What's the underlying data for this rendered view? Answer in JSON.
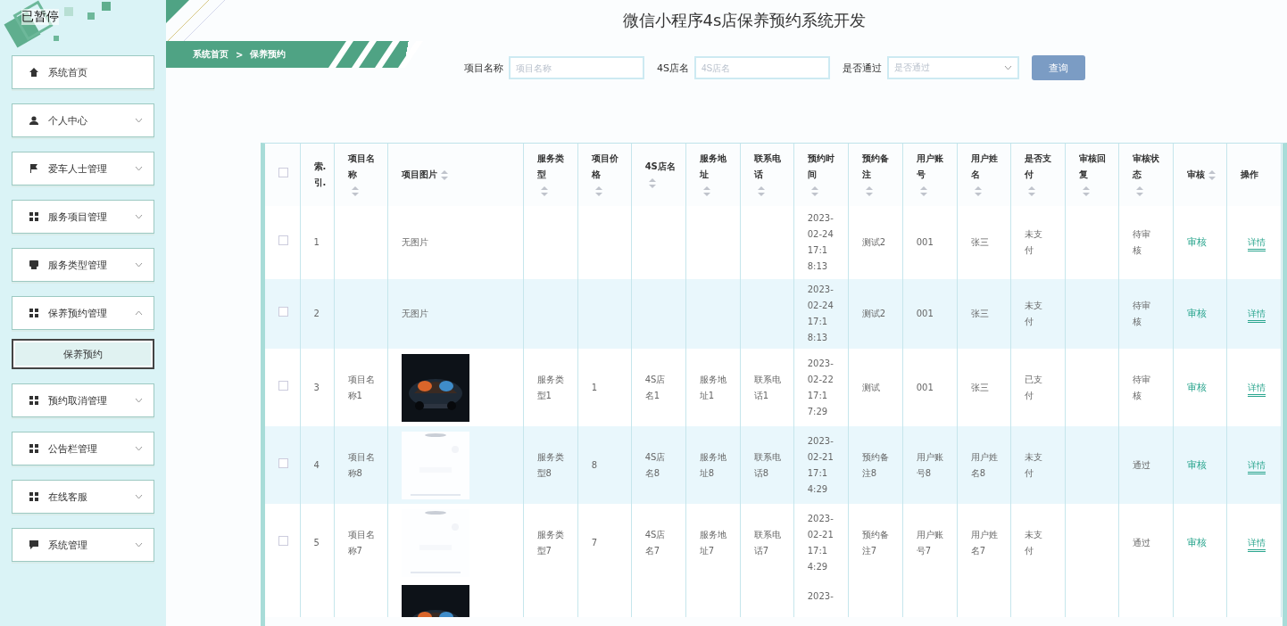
{
  "overlay_text": "已暂停",
  "sidebar": {
    "items": [
      {
        "label": "系统首页",
        "has_children": false
      },
      {
        "label": "个人中心",
        "has_children": true,
        "expanded": false
      },
      {
        "label": "爱车人士管理",
        "has_children": true,
        "expanded": false
      },
      {
        "label": "服务项目管理",
        "has_children": true,
        "expanded": false
      },
      {
        "label": "服务类型管理",
        "has_children": true,
        "expanded": false
      },
      {
        "label": "保养预约管理",
        "has_children": true,
        "expanded": true,
        "children": [
          {
            "label": "保养预约",
            "selected": true
          }
        ]
      },
      {
        "label": "预约取消管理",
        "has_children": true,
        "expanded": false
      },
      {
        "label": "公告栏管理",
        "has_children": true,
        "expanded": false
      },
      {
        "label": "在线客服",
        "has_children": true,
        "expanded": false
      },
      {
        "label": "系统管理",
        "has_children": true,
        "expanded": false
      }
    ]
  },
  "title": "微信小程序4s店保养预约系统开发",
  "breadcrumb": [
    "系统首页",
    ">",
    "保养预约"
  ],
  "filters": [
    {
      "kind": "text",
      "label": "项目名称",
      "placeholder": "项目名称"
    },
    {
      "kind": "text",
      "label": "4S店名",
      "placeholder": "4S店名"
    },
    {
      "kind": "select",
      "label": "是否通过",
      "placeholder": "是否通过"
    }
  ],
  "search_button": "查询",
  "table": {
    "header_checked": false,
    "columns": [
      {
        "label": "索.引.",
        "sortable": false
      },
      {
        "label": "项目名称",
        "sortable": true
      },
      {
        "label": "项目图片",
        "sortable": true
      },
      {
        "label": "服务类型",
        "sortable": true
      },
      {
        "label": "项目价格",
        "sortable": true
      },
      {
        "label": "4S店名",
        "sortable": true
      },
      {
        "label": "服务地址",
        "sortable": true
      },
      {
        "label": "联系电话",
        "sortable": true
      },
      {
        "label": "预约时间",
        "sortable": true
      },
      {
        "label": "预约备注",
        "sortable": true
      },
      {
        "label": "用户账号",
        "sortable": true
      },
      {
        "label": "用户姓名",
        "sortable": true
      },
      {
        "label": "是否支付",
        "sortable": true
      },
      {
        "label": "审核回复",
        "sortable": true
      },
      {
        "label": "审核状态",
        "sortable": true
      },
      {
        "label": "审核",
        "sortable": true
      },
      {
        "label": "操作",
        "sortable": false
      }
    ],
    "rows": [
      {
        "checked": false,
        "index": "1",
        "name": "",
        "picture": {
          "kind": "none",
          "text": "无图片"
        },
        "type": "",
        "price": "",
        "shop": "",
        "address": "",
        "phone": "",
        "time": "2023-02-24 17:18:13",
        "note": "测试2",
        "account": "001",
        "username": "张三",
        "paid": "未支付",
        "reply": "",
        "status": "待审核",
        "audit": "审核",
        "action": "详情"
      },
      {
        "checked": false,
        "index": "2",
        "name": "",
        "picture": {
          "kind": "none",
          "text": "无图片"
        },
        "type": "",
        "price": "",
        "shop": "",
        "address": "",
        "phone": "",
        "time": "2023-02-24 17:18:13",
        "note": "测试2",
        "account": "001",
        "username": "张三",
        "paid": "未支付",
        "reply": "",
        "status": "待审核",
        "audit": "审核",
        "action": "详情"
      },
      {
        "checked": false,
        "index": "3",
        "name": "项目名称1",
        "type": "服务类型1",
        "price": "1",
        "shop": "4S店名1",
        "address": "服务地址1",
        "phone": "联系电话1",
        "time": "2023-02-22 17:17:29",
        "note": "测试",
        "account": "001",
        "username": "张三",
        "paid": "已支付",
        "reply": "",
        "status": "待审核",
        "audit": "审核",
        "action": "详情"
      },
      {
        "checked": false,
        "index": "4",
        "name": "项目名称8",
        "type": "服务类型8",
        "price": "8",
        "shop": "4S店名8",
        "address": "服务地址8",
        "phone": "联系电话8",
        "time": "2023-02-21 17:14:29",
        "note": "预约备注8",
        "account": "用户账号8",
        "username": "用户姓名8",
        "paid": "未支付",
        "reply": "",
        "status": "通过",
        "audit": "审核",
        "action": "详情"
      },
      {
        "checked": false,
        "index": "5",
        "name": "项目名称7",
        "type": "服务类型7",
        "price": "7",
        "shop": "4S店名7",
        "address": "服务地址7",
        "phone": "联系电话7",
        "time": "2023-02-21 17:14:29",
        "note": "预约备注7",
        "account": "用户账号7",
        "username": "用户姓名7",
        "paid": "未支付",
        "reply": "",
        "status": "通过",
        "audit": "审核",
        "action": "详情"
      }
    ],
    "partial_row": {
      "time": "2023-"
    }
  }
}
